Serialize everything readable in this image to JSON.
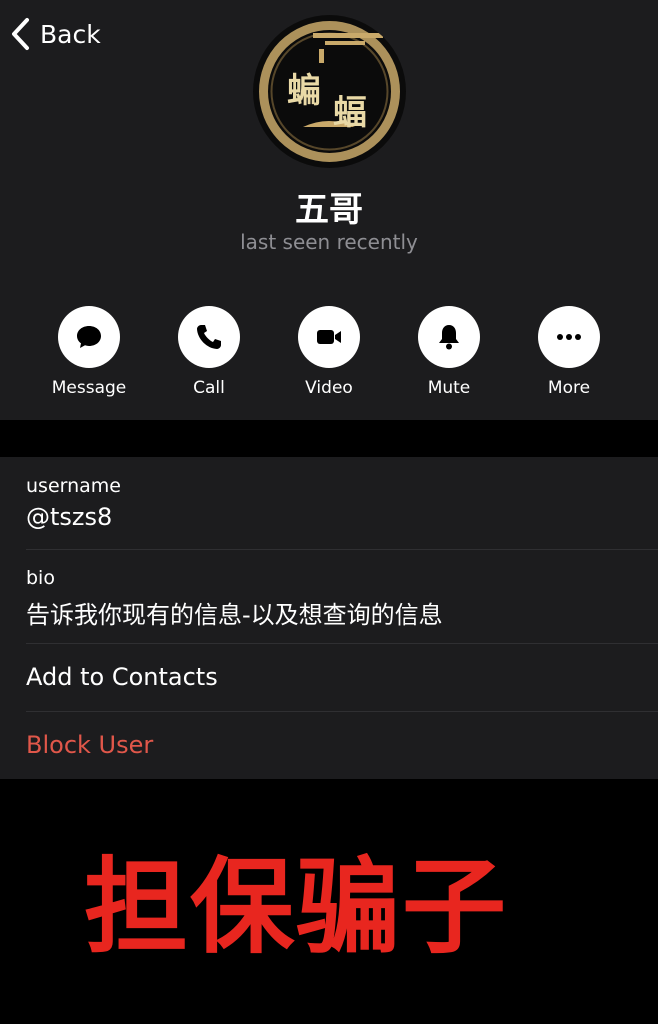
{
  "nav": {
    "back_label": "Back"
  },
  "profile": {
    "avatar_chars": [
      "蝙",
      "蝠"
    ],
    "name": "五哥",
    "status": "last seen recently"
  },
  "actions": [
    {
      "label": "Message",
      "icon": "message-bubble-icon"
    },
    {
      "label": "Call",
      "icon": "phone-icon"
    },
    {
      "label": "Video",
      "icon": "video-camera-icon"
    },
    {
      "label": "Mute",
      "icon": "bell-icon"
    },
    {
      "label": "More",
      "icon": "ellipsis-icon"
    }
  ],
  "info": {
    "username_label": "username",
    "username_value": "@tszs8",
    "bio_label": "bio",
    "bio_value": "告诉我你现有的信息-以及想查询的信息",
    "add_contacts_label": "Add to Contacts",
    "block_user_label": "Block User"
  },
  "overlay_text": "担保骗子",
  "colors": {
    "panel": "#1c1c1e",
    "background": "#000000",
    "muted_text": "#8e8e93",
    "destructive": "#e0574a",
    "overlay": "#e8261f",
    "avatar_gold": "#c9a96a"
  }
}
